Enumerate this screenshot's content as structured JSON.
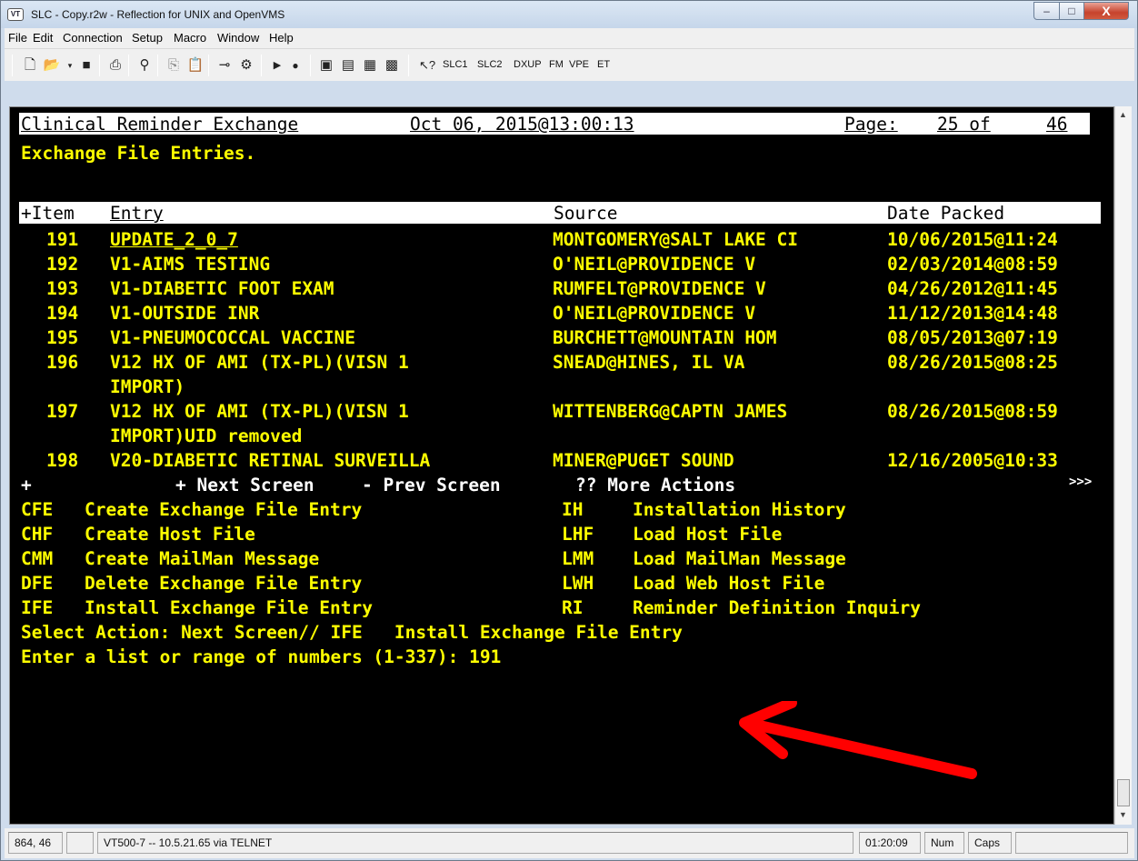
{
  "window": {
    "title": "SLC - Copy.r2w - Reflection for UNIX and OpenVMS",
    "icon_label": "VT",
    "min": "–",
    "max": "□",
    "close": "X"
  },
  "menu": [
    "File",
    "Edit",
    "Connection",
    "Setup",
    "Macro",
    "Window",
    "Help"
  ],
  "toolbar": {
    "text_buttons": [
      "SLC1",
      "SLC2",
      "DXUP",
      "FM",
      "VPE",
      "ET"
    ]
  },
  "terminal": {
    "header": {
      "title": "Clinical Reminder Exchange",
      "datetime": "Oct 06, 2015@13:00:13",
      "page_label": "Page:",
      "page_num": "25 of",
      "page_total": "46"
    },
    "subtitle": "Exchange File Entries.",
    "columns": {
      "item": "+Item",
      "entry": "Entry",
      "source": "Source",
      "date": "Date Packed"
    },
    "rows": [
      {
        "num": "191",
        "entry": "UPDATE_2_0_7",
        "source": "MONTGOMERY@SALT LAKE CI",
        "date": "10/06/2015@11:24"
      },
      {
        "num": "192",
        "entry": "V1-AIMS TESTING",
        "source": "O'NEIL@PROVIDENCE V",
        "date": "02/03/2014@08:59"
      },
      {
        "num": "193",
        "entry": "V1-DIABETIC FOOT EXAM",
        "source": "RUMFELT@PROVIDENCE V",
        "date": "04/26/2012@11:45"
      },
      {
        "num": "194",
        "entry": "V1-OUTSIDE INR",
        "source": "O'NEIL@PROVIDENCE V",
        "date": "11/12/2013@14:48"
      },
      {
        "num": "195",
        "entry": "V1-PNEUMOCOCCAL VACCINE",
        "source": "BURCHETT@MOUNTAIN HOM",
        "date": "08/05/2013@07:19"
      },
      {
        "num": "196",
        "entry": "V12 HX OF AMI (TX-PL)(VISN 1",
        "source": "SNEAD@HINES, IL VA",
        "date": "08/26/2015@08:25",
        "cont": "IMPORT)"
      },
      {
        "num": "197",
        "entry": "V12 HX OF AMI (TX-PL)(VISN 1",
        "source": "WITTENBERG@CAPTN JAMES",
        "date": "08/26/2015@08:59",
        "cont": "IMPORT)UID removed"
      },
      {
        "num": "198",
        "entry": "V20-DIABETIC RETINAL SURVEILLA",
        "source": "MINER@PUGET SOUND",
        "date": "12/16/2005@10:33"
      }
    ],
    "nav": {
      "plus": "+",
      "next": "+ Next Screen",
      "prev": "- Prev Screen",
      "more": "?? More Actions",
      "arrows": ">>>"
    },
    "actions": [
      {
        "code": "CFE",
        "label": "Create Exchange File Entry",
        "code2": "IH",
        "label2": "Installation History"
      },
      {
        "code": "CHF",
        "label": "Create Host File",
        "code2": "LHF",
        "label2": "Load Host File"
      },
      {
        "code": "CMM",
        "label": "Create MailMan Message",
        "code2": "LMM",
        "label2": "Load MailMan Message"
      },
      {
        "code": "DFE",
        "label": "Delete Exchange File Entry",
        "code2": "LWH",
        "label2": "Load Web Host File"
      },
      {
        "code": "IFE",
        "label": "Install Exchange File Entry",
        "code2": "RI",
        "label2": "Reminder Definition Inquiry"
      }
    ],
    "prompt1": "Select Action: Next Screen// IFE   Install Exchange File Entry",
    "prompt2": "Enter a list or range of numbers (1-337): 191"
  },
  "status": {
    "position": "864, 46",
    "connection": "VT500-7 -- 10.5.21.65 via TELNET",
    "time": "01:20:09",
    "num": "Num",
    "caps": "Caps"
  },
  "colors": {
    "terminal_bg": "#000000",
    "terminal_fg": "#ffff00",
    "header_bg": "#ffffff",
    "arrow": "#ff0000"
  }
}
